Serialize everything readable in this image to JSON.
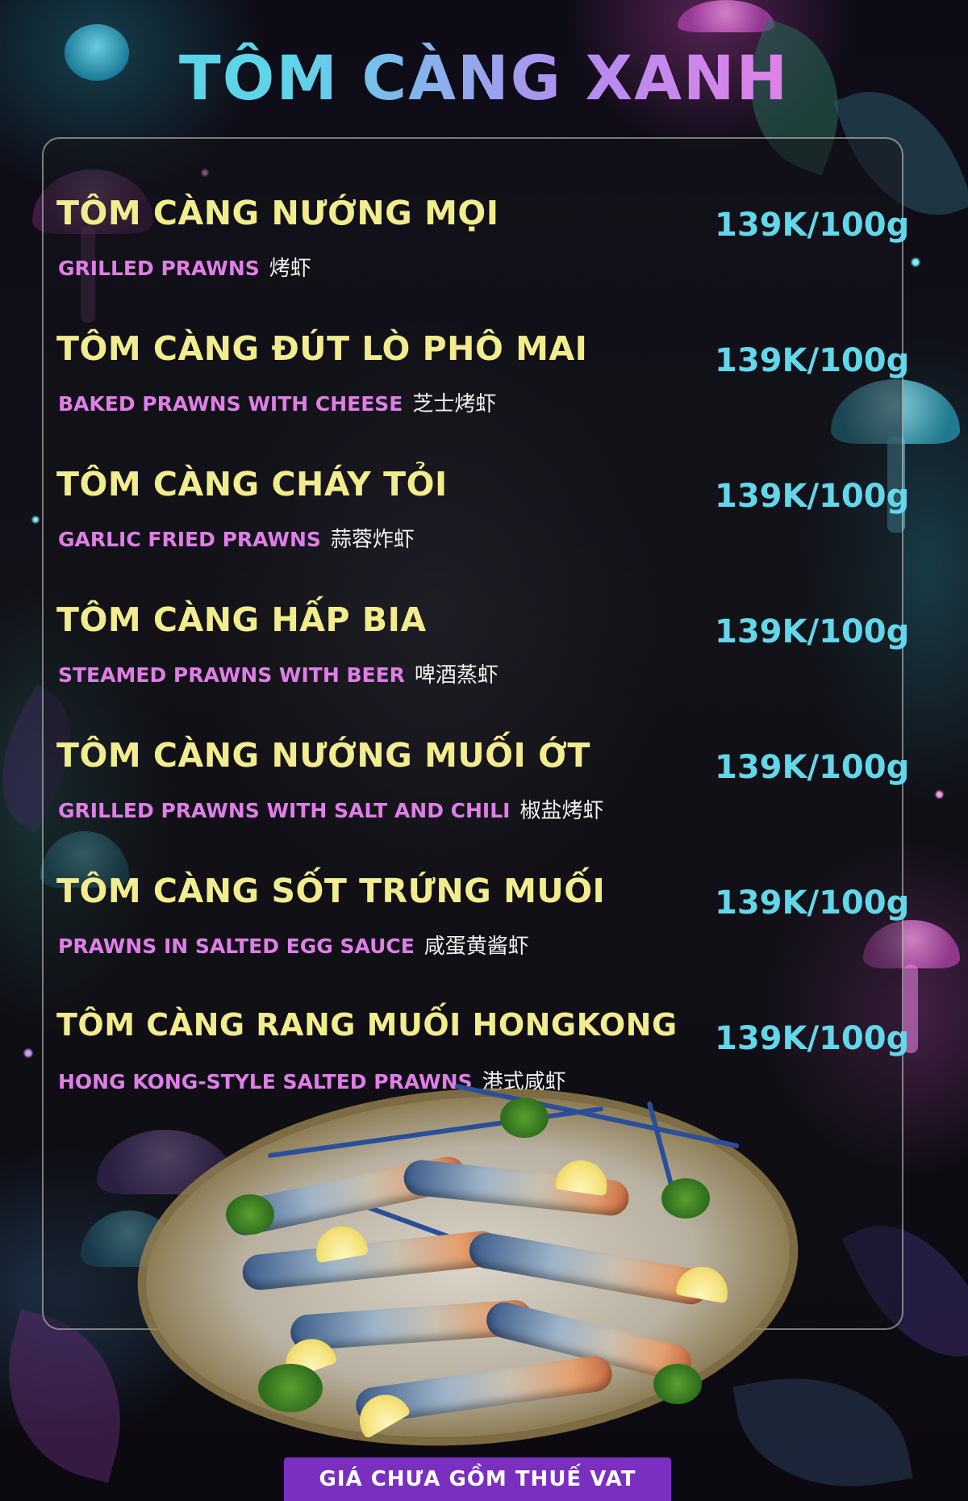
{
  "title": "TÔM CÀNG XANH",
  "items": [
    {
      "name": "TÔM CÀNG NƯỚNG MỌI",
      "english": "GRILLED PRAWNS",
      "chinese": "烤虾",
      "price": "139K/100g"
    },
    {
      "name": "TÔM CÀNG ĐÚT LÒ PHÔ MAI",
      "english": "BAKED PRAWNS WITH CHEESE",
      "chinese": "芝士烤虾",
      "price": "139K/100g"
    },
    {
      "name": "TÔM CÀNG CHÁY TỎI",
      "english": "GARLIC FRIED PRAWNS",
      "chinese": "蒜蓉炸虾",
      "price": "139K/100g"
    },
    {
      "name": "TÔM CÀNG HẤP BIA",
      "english": "STEAMED PRAWNS WITH BEER",
      "chinese": "啤酒蒸虾",
      "price": "139K/100g"
    },
    {
      "name": "TÔM CÀNG NƯỚNG MUỐI ỚT",
      "english": "GRILLED PRAWNS WITH SALT AND CHILI",
      "chinese": "椒盐烤虾",
      "price": "139K/100g"
    },
    {
      "name": "TÔM CÀNG SỐT TRỨNG MUỐI",
      "english": "PRAWNS IN SALTED EGG SAUCE",
      "chinese": "咸蛋黄酱虾",
      "price": "139K/100g"
    },
    {
      "name": "TÔM CÀNG RANG MUỐI HONGKONG",
      "english": "HONG KONG-STYLE SALTED PRAWNS",
      "chinese": "港式咸虾",
      "price": "139K/100g"
    }
  ],
  "footer": {
    "note": "GIÁ CHƯA GỒM THUẾ VAT"
  },
  "colors": {
    "name": "#f2ec8e",
    "english": "#e07ee8",
    "price": "#63d7ea",
    "footer_bg": "#7a2fc0"
  }
}
